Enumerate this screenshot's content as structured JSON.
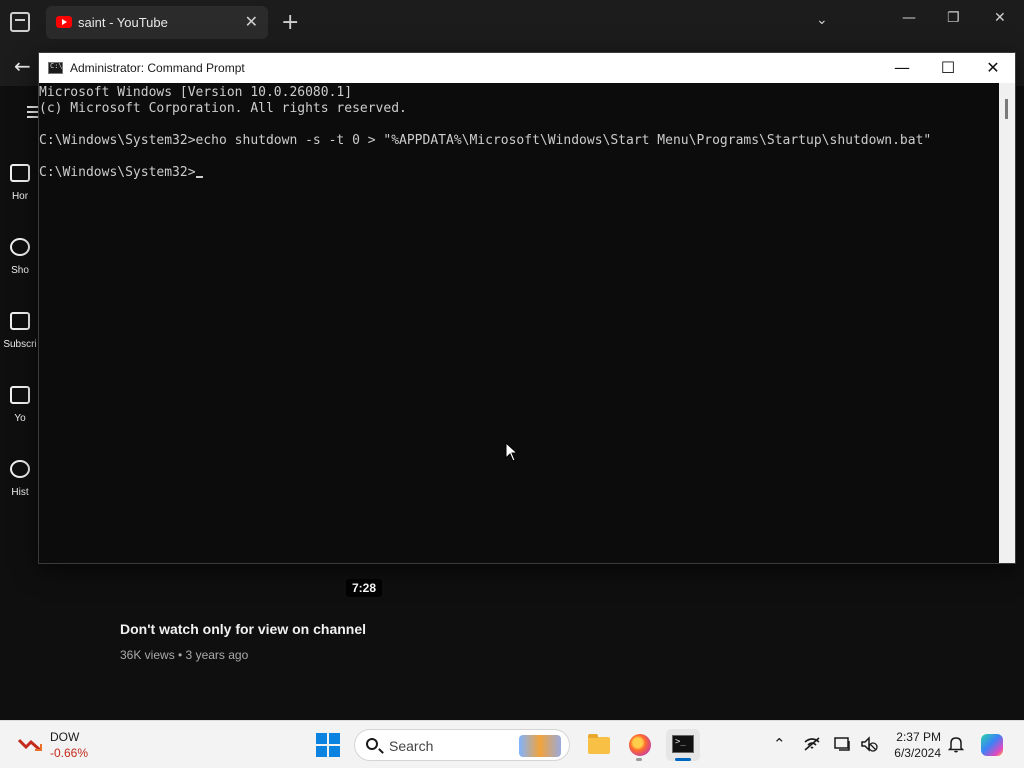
{
  "browser": {
    "tab_title": "saint - YouTube",
    "tab_close": "✕",
    "new_tab": "+",
    "tab_list": "⌄",
    "minimize": "—",
    "restore": "❐",
    "close": "✕",
    "back": "←"
  },
  "youtube": {
    "nav": [
      {
        "label": "Hor",
        "icon": "home-icon"
      },
      {
        "label": "Sho",
        "icon": "shorts-icon"
      },
      {
        "label": "Subscri",
        "icon": "subscriptions-icon"
      },
      {
        "label": "Yo",
        "icon": "you-icon"
      },
      {
        "label": "Hist",
        "icon": "history-icon"
      }
    ],
    "video": {
      "duration": "7:28",
      "title": "Don't watch only for view on channel",
      "meta": "36K views • 3 years ago"
    }
  },
  "cmd": {
    "title": "Administrator: Command Prompt",
    "minimize": "—",
    "maximize": "☐",
    "close": "✕",
    "lines": [
      "Microsoft Windows [Version 10.0.26080.1]",
      "(c) Microsoft Corporation. All rights reserved.",
      "C:\\Windows\\System32>echo shutdown -s -t 0 > \"%APPDATA%\\Microsoft\\Windows\\Start Menu\\Programs\\Startup\\shutdown.bat\"",
      "C:\\Windows\\System32>"
    ]
  },
  "taskbar": {
    "stock_name": "DOW",
    "stock_change": "-0.66%",
    "search_label": "Search",
    "tray": {
      "chevron": "⌃",
      "time": "2:37 PM",
      "date": "6/3/2024"
    }
  },
  "colors": {
    "stock_negative": "#c42b1c",
    "windows_blue": "#0a84e0",
    "terminal_text": "#cccccc",
    "youtube_red": "#ff0000"
  }
}
